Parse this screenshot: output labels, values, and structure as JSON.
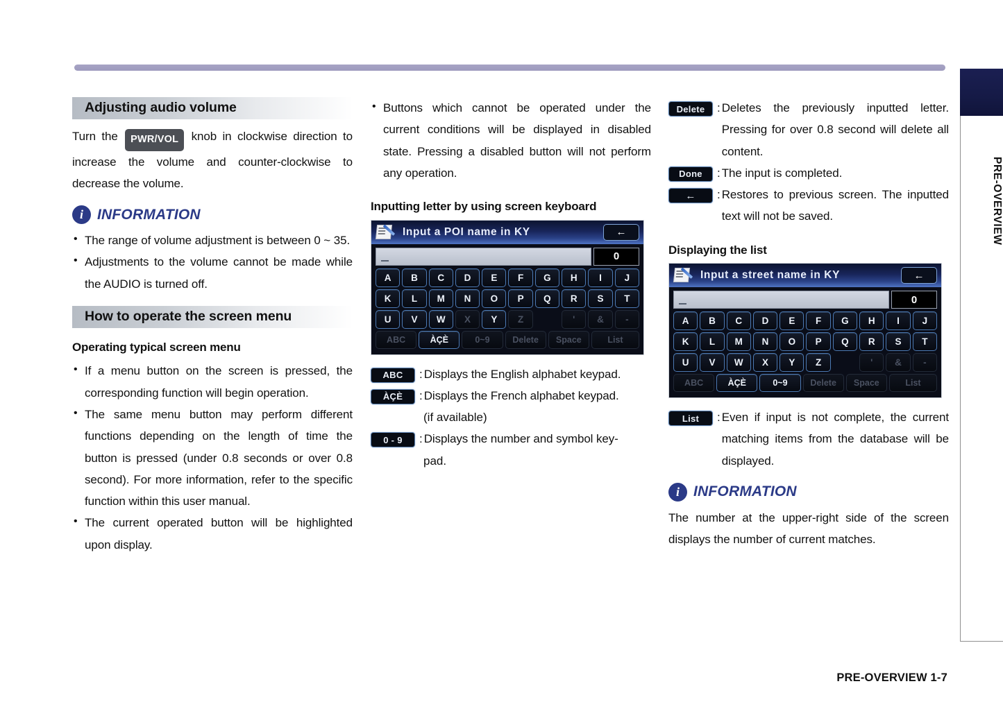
{
  "page": {
    "side_tab_label": "PRE-OVERVIEW",
    "footer": "PRE-OVERVIEW   1-7"
  },
  "col1": {
    "section_heading": "Adjusting audio volume",
    "intro_before": "Turn the ",
    "intro_keycap": "PWR/VOL",
    "intro_after": " knob in clockwise direction to increase the volume and counter-clockwise to decrease the volume.",
    "information_label": "INFORMATION",
    "information_icon": "i",
    "info_bullets": [
      "The range of volume adjustment is between 0 ~ 35.",
      "Adjustments to the volume cannot be made while the AUDIO is turned off."
    ],
    "section_heading2": "How to operate the screen menu",
    "sub_heading": "Operating typical screen menu",
    "bullets": [
      "If a menu button on the screen is pressed, the corresponding function will begin operation.",
      "The same menu button may perform different functions depending on the length of time the button is pressed (under 0.8 seconds or over 0.8 second). For more information, refer to the specific function within this user manual.",
      "The current operated button will be highlighted upon display."
    ]
  },
  "col2": {
    "bullets": [
      "Buttons which cannot be operated under the current conditions will be displayed in disabled state. Pressing a disabled button will not perform any operation."
    ],
    "sub_heading": "Inputting letter by using screen keyboard",
    "keyboard": {
      "title": "Input a POI name in KY",
      "back_icon": "←",
      "counter": "0",
      "rows": [
        [
          {
            "label": "A",
            "state": "on"
          },
          {
            "label": "B",
            "state": "on"
          },
          {
            "label": "C",
            "state": "on"
          },
          {
            "label": "D",
            "state": "on"
          },
          {
            "label": "E",
            "state": "on"
          },
          {
            "label": "F",
            "state": "on"
          },
          {
            "label": "G",
            "state": "on"
          },
          {
            "label": "H",
            "state": "on"
          },
          {
            "label": "I",
            "state": "on"
          },
          {
            "label": "J",
            "state": "on"
          }
        ],
        [
          {
            "label": "K",
            "state": "on"
          },
          {
            "label": "L",
            "state": "on"
          },
          {
            "label": "M",
            "state": "on"
          },
          {
            "label": "N",
            "state": "on"
          },
          {
            "label": "O",
            "state": "on"
          },
          {
            "label": "P",
            "state": "on"
          },
          {
            "label": "Q",
            "state": "on"
          },
          {
            "label": "R",
            "state": "on"
          },
          {
            "label": "S",
            "state": "on"
          },
          {
            "label": "T",
            "state": "on"
          }
        ],
        [
          {
            "label": "U",
            "state": "on"
          },
          {
            "label": "V",
            "state": "on"
          },
          {
            "label": "W",
            "state": "on"
          },
          {
            "label": "X",
            "state": "off"
          },
          {
            "label": "Y",
            "state": "on"
          },
          {
            "label": "Z",
            "state": "off"
          },
          {
            "label": "",
            "state": "blank"
          },
          {
            "label": "'",
            "state": "off"
          },
          {
            "label": "&",
            "state": "off"
          },
          {
            "label": "-",
            "state": "off"
          }
        ]
      ],
      "function_row": [
        {
          "label": "ABC",
          "state": "off",
          "width": "wide"
        },
        {
          "label": "ÀÇÈ",
          "state": "on",
          "width": "wide"
        },
        {
          "label": "0~9",
          "state": "off",
          "width": "wide"
        },
        {
          "label": "Delete",
          "state": "off",
          "width": "wide"
        },
        {
          "label": "Space",
          "state": "off",
          "width": "wide"
        },
        {
          "label": "List",
          "state": "off",
          "width": "list"
        }
      ]
    },
    "legend": [
      {
        "badge": "ABC",
        "text": "Displays the English alphabet keypad.",
        "cont": ""
      },
      {
        "badge": "ÀÇÈ",
        "text": "Displays the French alphabet keypad.",
        "cont": "(if available)"
      },
      {
        "badge": "0 - 9",
        "text": "Displays the number and symbol key-",
        "cont": "pad."
      }
    ]
  },
  "col3": {
    "legend_top": [
      {
        "badge": "Delete",
        "text": "Deletes the previously inputted letter. Pressing for over 0.8 second will delete all content.",
        "cont": ""
      },
      {
        "badge": "Done",
        "text": "The input is completed.",
        "cont": ""
      },
      {
        "badge": "←",
        "text": "Restores to previous screen. The inputted text will not be saved.",
        "cont": ""
      }
    ],
    "sub_heading": "Displaying the list",
    "keyboard": {
      "title": "Input a street name in KY",
      "back_icon": "←",
      "counter": "0",
      "rows": [
        [
          {
            "label": "A",
            "state": "on"
          },
          {
            "label": "B",
            "state": "on"
          },
          {
            "label": "C",
            "state": "on"
          },
          {
            "label": "D",
            "state": "on"
          },
          {
            "label": "E",
            "state": "on"
          },
          {
            "label": "F",
            "state": "on"
          },
          {
            "label": "G",
            "state": "on"
          },
          {
            "label": "H",
            "state": "on"
          },
          {
            "label": "I",
            "state": "on"
          },
          {
            "label": "J",
            "state": "on"
          }
        ],
        [
          {
            "label": "K",
            "state": "on"
          },
          {
            "label": "L",
            "state": "on"
          },
          {
            "label": "M",
            "state": "on"
          },
          {
            "label": "N",
            "state": "on"
          },
          {
            "label": "O",
            "state": "on"
          },
          {
            "label": "P",
            "state": "on"
          },
          {
            "label": "Q",
            "state": "on"
          },
          {
            "label": "R",
            "state": "on"
          },
          {
            "label": "S",
            "state": "on"
          },
          {
            "label": "T",
            "state": "on"
          }
        ],
        [
          {
            "label": "U",
            "state": "on"
          },
          {
            "label": "V",
            "state": "on"
          },
          {
            "label": "W",
            "state": "on"
          },
          {
            "label": "X",
            "state": "on"
          },
          {
            "label": "Y",
            "state": "on"
          },
          {
            "label": "Z",
            "state": "on"
          },
          {
            "label": "",
            "state": "blank"
          },
          {
            "label": "'",
            "state": "off"
          },
          {
            "label": "&",
            "state": "off"
          },
          {
            "label": "-",
            "state": "off"
          }
        ]
      ],
      "function_row": [
        {
          "label": "ABC",
          "state": "off",
          "width": "wide"
        },
        {
          "label": "ÀÇÈ",
          "state": "on",
          "width": "wide"
        },
        {
          "label": "0~9",
          "state": "on",
          "width": "wide"
        },
        {
          "label": "Delete",
          "state": "off",
          "width": "wide"
        },
        {
          "label": "Space",
          "state": "off",
          "width": "wide"
        },
        {
          "label": "List",
          "state": "off",
          "width": "list"
        }
      ]
    },
    "legend_bottom": [
      {
        "badge": "List",
        "text": "Even if input is not complete, the current matching items from the database will be displayed.",
        "cont": ""
      }
    ],
    "information_label": "INFORMATION",
    "information_icon": "i",
    "info_text": "The number at the upper-right side of the screen displays the number of current matches."
  },
  "colors": {
    "rule": "#a7a4c4",
    "info_navy": "#2b3a87",
    "tab_navy": "#151a46",
    "key_border": "#4c7ab4"
  }
}
